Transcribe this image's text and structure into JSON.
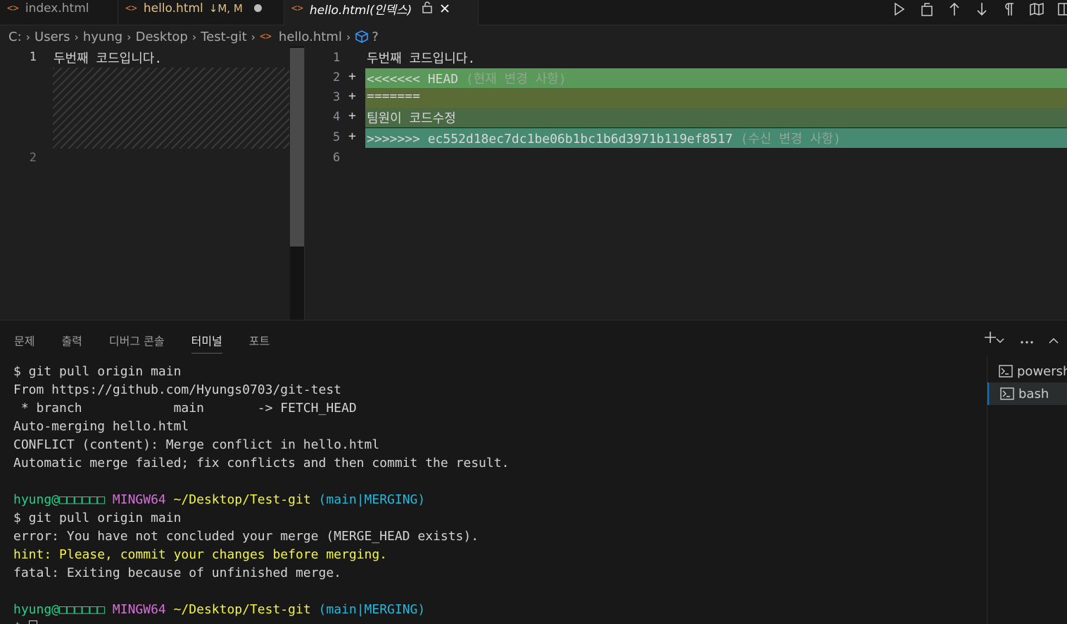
{
  "tabs": [
    {
      "label": "index.html",
      "icon": "html-file-icon"
    },
    {
      "label": "hello.html",
      "status": "↓M, M",
      "icon": "html-file-icon"
    },
    {
      "label": "hello.html(인덱스)",
      "icon": "html-file-icon"
    }
  ],
  "breadcrumb": {
    "items": [
      "C:",
      "Users",
      "hyung",
      "Desktop",
      "Test-git",
      "hello.html"
    ],
    "symbol": "?",
    "file_glyph": "<>"
  },
  "editor": {
    "left": {
      "line_numbers": [
        "1",
        "2"
      ],
      "lines": [
        "두번째 코드입니다."
      ]
    },
    "right": {
      "line_numbers": [
        "1",
        "2",
        "3",
        "4",
        "5",
        "6"
      ],
      "plus": "+",
      "line1": "두번째 코드입니다.",
      "line2_marker": "<<<<<<< HEAD",
      "line2_note": "(현재 변경 사항)",
      "line3": "=======",
      "line4": "팀원이 코드수정",
      "line5_marker": ">>>>>>> ec552d18ec7dc1be06b1bc1b6d3971b119ef8517",
      "line5_note": "(수신 변경 사항)"
    }
  },
  "panel": {
    "tabs": [
      "문제",
      "출력",
      "디버그 콘솔",
      "터미널",
      "포트"
    ],
    "active_tab": "터미널",
    "terminal_list": [
      "powershell",
      "bash"
    ],
    "terminal": {
      "l1": "$ git pull origin main",
      "l2": "From https://github.com/Hyungs0703/git-test",
      "l3": " * branch            main       -> FETCH_HEAD",
      "l4": "Auto-merging hello.html",
      "l5": "CONFLICT (content): Merge conflict in hello.html",
      "l6": "Automatic merge failed; fix conflicts and then commit the result.",
      "prompt_user": "hyung@□□□□□□",
      "prompt_sys": "MINGW64",
      "prompt_path": "~/Desktop/Test-git",
      "prompt_branch": "(main|MERGING)",
      "l8": "$ git pull origin main",
      "l9": "error: You have not concluded your merge (MERGE_HEAD exists).",
      "l10": "hint: Please, commit your changes before merging.",
      "l11": "fatal: Exiting because of unfinished merge.",
      "last_prompt": "$ "
    }
  },
  "colors": {
    "diff_head": "#5a9959",
    "diff_sep": "#5a6b35",
    "diff_mid": "#4a6a45",
    "diff_incoming": "#468a73",
    "accent": "#0078d4"
  }
}
